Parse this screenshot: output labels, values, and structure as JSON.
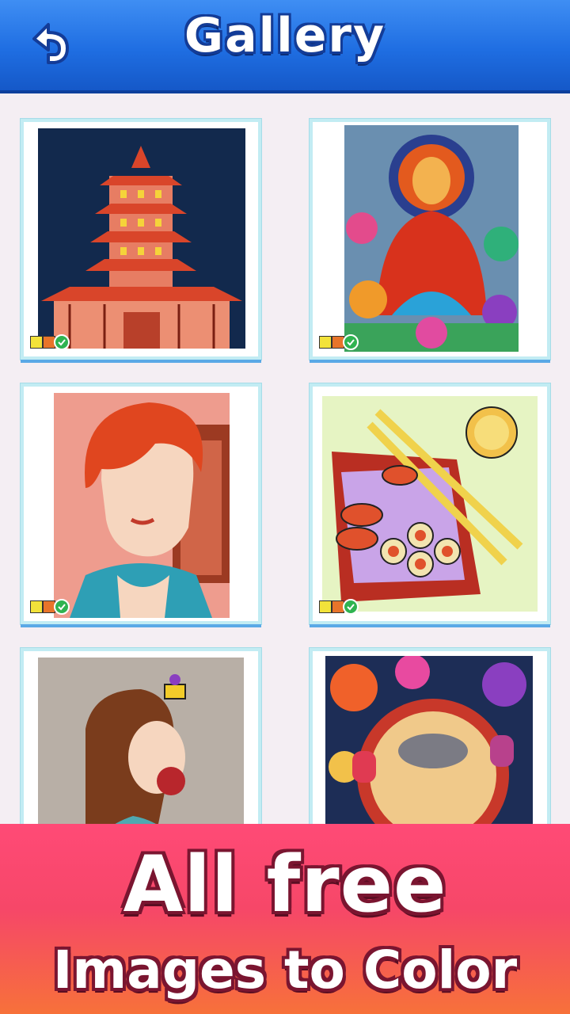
{
  "header": {
    "title": "Gallery",
    "back_icon": "undo-arrow-icon",
    "colors": {
      "bar": "#1f6ee2",
      "bar_light": "#3f8ef3"
    }
  },
  "gallery": {
    "items": [
      {
        "subject": "pagoda",
        "completed": true
      },
      {
        "subject": "buddha",
        "completed": true
      },
      {
        "subject": "portrait-boy",
        "completed": true
      },
      {
        "subject": "sushi",
        "completed": true
      },
      {
        "subject": "girl-pomegranate",
        "completed": false
      },
      {
        "subject": "rat-medallion",
        "completed": false
      }
    ],
    "progress_swatches": [
      "#f2e23a",
      "#e8742a",
      "#c6451b"
    ]
  },
  "banner": {
    "line1": "All free",
    "line2": "Images to Color",
    "colors": {
      "top": "#ff4a76",
      "bottom": "#f7713a"
    }
  }
}
